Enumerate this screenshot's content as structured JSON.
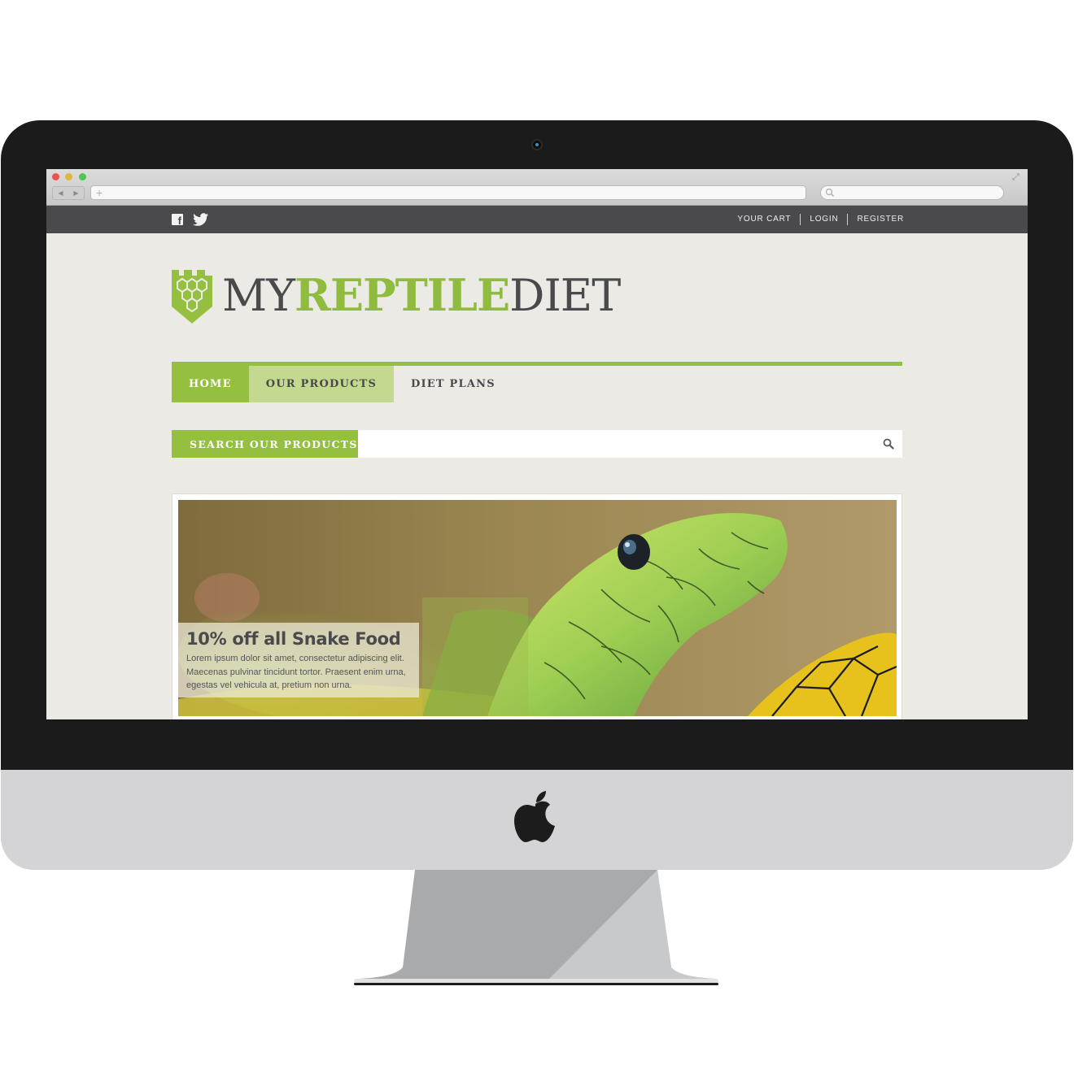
{
  "site": {
    "social": {
      "facebook_icon": "facebook-icon",
      "twitter_icon": "twitter-icon"
    },
    "top_links": [
      "YOUR CART",
      "LOGIN",
      "REGISTER"
    ],
    "logo": {
      "part1": "MY",
      "part2": "REPTILE",
      "part3": "DIET"
    },
    "nav": {
      "home": "HOME",
      "products": "OUR PRODUCTS",
      "plans": "DIET PLANS"
    },
    "search": {
      "label": "SEARCH OUR PRODUCTS",
      "placeholder": ""
    },
    "hero": {
      "title": "10% off all Snake Food",
      "body": "Lorem ipsum dolor sit amet, consectetur adipiscing elit. Maecenas pulvinar tincidunt tortor. Praesent enim urna, egestas vel vehicula at, pretium non urna."
    }
  },
  "colors": {
    "accent_green": "#95c03f",
    "light_green": "#c3d98f",
    "dark_gray": "#4a4a4c",
    "background": "#ebeae5"
  }
}
